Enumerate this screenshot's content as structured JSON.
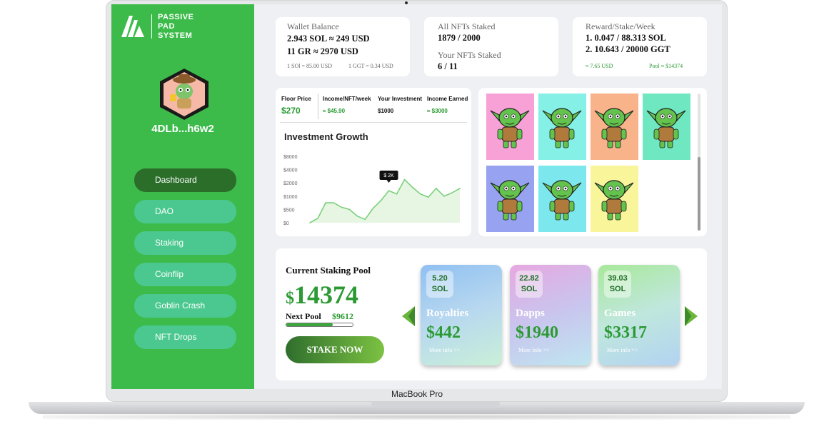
{
  "laptop": {
    "brand": "MacBook Pro"
  },
  "sidebar": {
    "logo": {
      "line1": "PASSIVE",
      "line2": "PAD",
      "line3": "SYSTEM"
    },
    "wallet_address": "4DLb...h6w2",
    "nav": [
      {
        "label": "Dashboard",
        "active": true
      },
      {
        "label": "DAO"
      },
      {
        "label": "Staking"
      },
      {
        "label": "Coinflip"
      },
      {
        "label": "Goblin Crash"
      },
      {
        "label": "NFT Drops"
      }
    ]
  },
  "wallet_balance": {
    "title": "Wallet Balance",
    "line1": "2.943 SOL ≈ 249 USD",
    "line2": "11 GR ≈ 2970 USD",
    "rate1": "1 SOl = 85.00 USD",
    "rate2": "1 GGT = 0.34 USD"
  },
  "nfts_staked": {
    "all_title": "All NFTs Staked",
    "all_value": "1879 / 2000",
    "yours_title": "Your NFTs Staked",
    "yours_value": "6 / 11"
  },
  "reward": {
    "title": "Reward/Stake/Week",
    "line1": "1. 0.047 / 88.313 SOL",
    "line2": "2. 10.643 / 20000 GGT",
    "usd": "≈ 7.65 USD",
    "pool": "Pool ≈ $14374"
  },
  "metrics": {
    "floor_price": {
      "label": "Floor Price",
      "value": "$270"
    },
    "income_week": {
      "label": "Income/NFT/week",
      "value": "≈ $45.90"
    },
    "investment": {
      "label": "Your Investment",
      "value": "$1000"
    },
    "income_earned": {
      "label": "Income Earned",
      "value": "≈ $3000"
    }
  },
  "chart_data": {
    "type": "area",
    "title": "Investment Growth",
    "y_ticks": [
      "$8000",
      "$4000",
      "$2000",
      "$1000",
      "$500",
      "$0"
    ],
    "ylim": [
      0,
      6
    ],
    "tooltip": "$ 2K",
    "tooltip_index": 10,
    "values": [
      0.0,
      0.4,
      1.8,
      1.8,
      1.4,
      1.2,
      0.6,
      0.3,
      1.3,
      2.0,
      2.9,
      2.6,
      3.9,
      3.2,
      2.6,
      2.3,
      3.1,
      2.4,
      2.7,
      3.1
    ],
    "color": "#7bd07b"
  },
  "nft_grid": [
    {
      "bg": "#f7a1d6",
      "name": "goblin-king-crown"
    },
    {
      "bg": "#85f0e6",
      "name": "goblin-sunglasses"
    },
    {
      "bg": "#f9b38a",
      "name": "goblin-plain"
    },
    {
      "bg": "#6fe8c2",
      "name": "goblin-viking-helmet"
    },
    {
      "bg": "#97a3f0",
      "name": "goblin-mask-sack"
    },
    {
      "bg": "#7ce8ee",
      "name": "goblin-headband"
    },
    {
      "bg": "#f8f59a",
      "name": "goblin-cowboy-hat"
    }
  ],
  "staking_pool": {
    "title": "Current Staking Pool",
    "amount": "14374",
    "currency": "$",
    "next_label": "Next Pool",
    "next_value": "$9612",
    "progress": 0.7,
    "button": "STAKE NOW"
  },
  "pools": [
    {
      "sol": "5.20",
      "unit": "SOL",
      "name": "Royalties",
      "amount": "442",
      "more": "More info  >>"
    },
    {
      "sol": "22.82",
      "unit": "SOL",
      "name": "Dapps",
      "amount": "1940",
      "more": "More Info  >>"
    },
    {
      "sol": "39.03",
      "unit": "SOL",
      "name": "Games",
      "amount": "3317",
      "more": "More info  >>"
    }
  ],
  "colors": {
    "sidebar": "#3cbb4a",
    "accent": "#2b9a33",
    "active_nav": "#2b6e2a",
    "nav": "#4ac88f"
  }
}
